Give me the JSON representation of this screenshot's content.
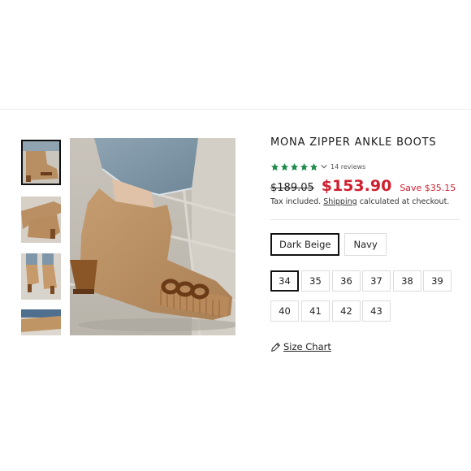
{
  "product": {
    "title": "MONA ZIPPER ANKLE BOOTS",
    "rating": {
      "stars": 5,
      "reviews_label": "14 reviews",
      "star_color": "#1d8a4a"
    },
    "price": {
      "original": "$189.05",
      "current": "$153.90",
      "savings": "Save $35.15",
      "sale_color": "#d01f2e"
    },
    "tax": {
      "prefix": "Tax included.",
      "link": "Shipping",
      "suffix": "calculated at checkout."
    },
    "colors": {
      "selected": "Dark Beige",
      "options": [
        "Dark Beige",
        "Navy"
      ]
    },
    "sizes": {
      "selected": "34",
      "options": [
        "34",
        "35",
        "36",
        "37",
        "38",
        "39",
        "40",
        "41",
        "42",
        "43"
      ]
    },
    "size_chart_label": "Size Chart",
    "size_chart_icon": "ruler-pencil-icon"
  },
  "gallery": {
    "active_index": 0,
    "thumbnail_count": 4
  }
}
